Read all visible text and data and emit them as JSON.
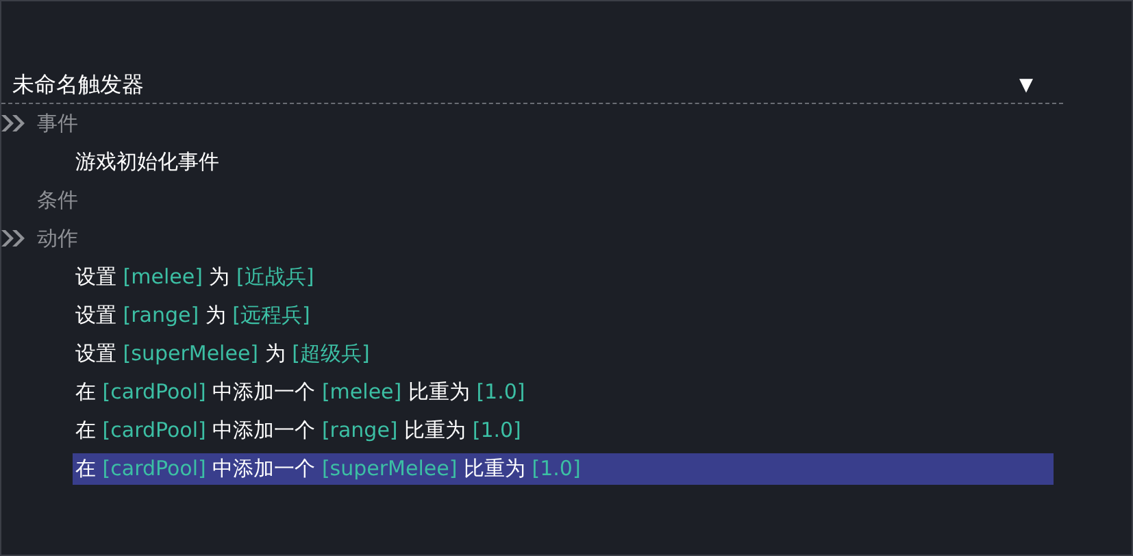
{
  "trigger": {
    "title": "未命名触发器",
    "dropdown_glyph": "▼"
  },
  "sections": [
    {
      "label": "事件",
      "children": [
        {
          "selected": false,
          "parts": [
            {
              "kind": "text",
              "text": "游戏初始化事件"
            }
          ]
        }
      ]
    },
    {
      "label": "条件"
    },
    {
      "label": "动作",
      "children": [
        {
          "selected": false,
          "parts": [
            {
              "kind": "text",
              "text": "设置"
            },
            {
              "kind": "param",
              "text": "[melee]"
            },
            {
              "kind": "text",
              "text": "为"
            },
            {
              "kind": "param",
              "text": "[近战兵]"
            }
          ]
        },
        {
          "selected": false,
          "parts": [
            {
              "kind": "text",
              "text": "设置"
            },
            {
              "kind": "param",
              "text": "[range]"
            },
            {
              "kind": "text",
              "text": "为"
            },
            {
              "kind": "param",
              "text": "[远程兵]"
            }
          ]
        },
        {
          "selected": false,
          "parts": [
            {
              "kind": "text",
              "text": "设置"
            },
            {
              "kind": "param",
              "text": "[superMelee]"
            },
            {
              "kind": "text",
              "text": "为"
            },
            {
              "kind": "param",
              "text": "[超级兵]"
            }
          ]
        },
        {
          "selected": false,
          "parts": [
            {
              "kind": "text",
              "text": "在"
            },
            {
              "kind": "param",
              "text": "[cardPool]"
            },
            {
              "kind": "text",
              "text": "中添加一个"
            },
            {
              "kind": "param",
              "text": "[melee]"
            },
            {
              "kind": "text",
              "text": "比重为"
            },
            {
              "kind": "param",
              "text": "[1.0]"
            }
          ]
        },
        {
          "selected": false,
          "parts": [
            {
              "kind": "text",
              "text": "在"
            },
            {
              "kind": "param",
              "text": "[cardPool]"
            },
            {
              "kind": "text",
              "text": "中添加一个"
            },
            {
              "kind": "param",
              "text": "[range]"
            },
            {
              "kind": "text",
              "text": "比重为"
            },
            {
              "kind": "param",
              "text": "[1.0]"
            }
          ]
        },
        {
          "selected": true,
          "parts": [
            {
              "kind": "text",
              "text": "在"
            },
            {
              "kind": "param",
              "text": "[cardPool]"
            },
            {
              "kind": "text",
              "text": "中添加一个"
            },
            {
              "kind": "param",
              "text": "[superMelee]"
            },
            {
              "kind": "text",
              "text": "比重为"
            },
            {
              "kind": "param",
              "text": "[1.0]"
            }
          ]
        }
      ]
    }
  ]
}
